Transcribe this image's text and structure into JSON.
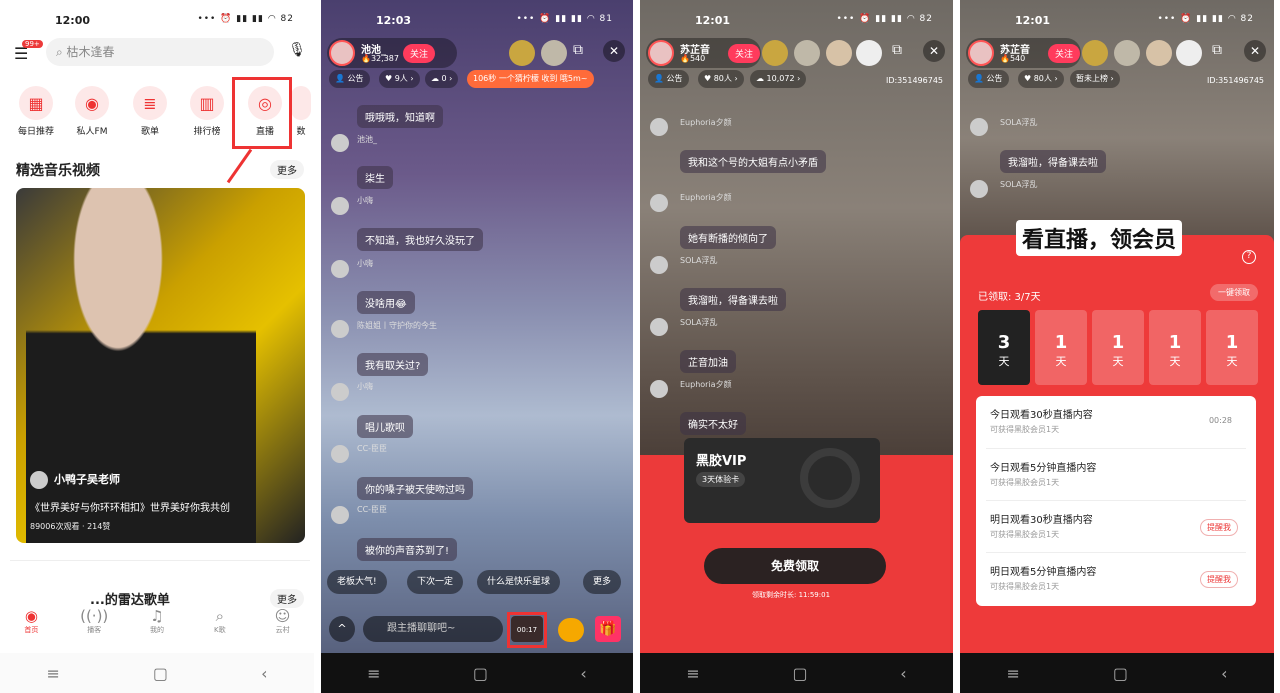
{
  "p1": {
    "time": "12:00",
    "battery": "82",
    "search_placeholder": "枯木逢春",
    "badge": "99+",
    "categories": [
      "每日推荐",
      "私人FM",
      "歌单",
      "排行榜",
      "直播",
      "数"
    ],
    "section_title": "精选音乐视频",
    "more": "更多",
    "video": {
      "author": "小鸭子吴老师",
      "title": "《世界美好与你环环相扣》世界美好你我共创",
      "stats": "89006次观看 · 214赞"
    },
    "section2": "...的雷达歌单",
    "more2": "更多",
    "tabs": [
      "首页",
      "播客",
      "我的",
      "K歌",
      "云村"
    ]
  },
  "p2": {
    "time": "12:03",
    "battery": "81",
    "host": "池池_",
    "fans": "32,387",
    "follow": "关注",
    "notice": "公告",
    "viewers": "9人",
    "likes": "0",
    "timer": "106秒",
    "task": "一个猜柠檬 收到 哦5m~",
    "messages": [
      "哦哦哦，知道啊",
      "柒生",
      "不知道，我也好久没玩了",
      "没啥用😂",
      "我有取关过?",
      "唱儿歌呗",
      "你的嗓子被天使吻过吗",
      "被你的声音苏到了!"
    ],
    "users": [
      "池池_",
      "小嗨",
      "小嗨",
      "陈姐姐丨守护你的今生",
      "小嗨",
      "CC-臣臣",
      "CC-臣臣"
    ],
    "quick": [
      "老板大气!",
      "下次一定",
      "什么是快乐星球",
      "更多"
    ],
    "input": "跟主播聊聊吧~",
    "vip_timer": "00:17"
  },
  "p3": {
    "time": "12:01",
    "battery": "82",
    "host": "苏芷音",
    "fans": "540",
    "follow": "关注",
    "notice": "公告",
    "viewers": "80人",
    "likes": "10,072",
    "room_id": "ID:351496745",
    "users": [
      "Euphoria夕颜",
      "Euphoria夕颜",
      "SOLA浮乱",
      "SOLA浮乱",
      "Euphoria夕颜"
    ],
    "messages": [
      "我和这个号的大姐有点小矛盾",
      "她有断播的倾向了",
      "我溜啦，得备课去啦",
      "芷音加油",
      "确实不太好"
    ],
    "card_title": "黑胶VIP",
    "card_sub": "3天体验卡",
    "claim": "免费领取",
    "claim_timer": "领取剩余时长: 11:59:01"
  },
  "p4": {
    "time": "12:01",
    "battery": "82",
    "host": "苏芷音",
    "fans": "540",
    "follow": "关注",
    "notice": "公告",
    "viewers": "80人",
    "rank": "暂未上榜",
    "room_id": "ID:351496745",
    "users": [
      "SOLA浮乱",
      "SOLA浮乱"
    ],
    "messages": [
      "我溜啦，得备课去啦"
    ],
    "banner": "看直播，领会员",
    "claimed": "已领取: 3/7天",
    "claim_all": "一键领取",
    "days": [
      {
        "n": "3",
        "u": "天"
      },
      {
        "n": "1",
        "u": "天"
      },
      {
        "n": "1",
        "u": "天"
      },
      {
        "n": "1",
        "u": "天"
      },
      {
        "n": "1",
        "u": "天"
      }
    ],
    "tasks": [
      {
        "a": "今日观看30秒直播内容",
        "b": "可获得黑胶会员1天",
        "r": "00:28"
      },
      {
        "a": "今日观看5分钟直播内容",
        "b": "可获得黑胶会员1天",
        "r": ""
      },
      {
        "a": "明日观看30秒直播内容",
        "b": "可获得黑胶会员1天",
        "r": "提醒我"
      },
      {
        "a": "明日观看5分钟直播内容",
        "b": "可获得黑胶会员1天",
        "r": "提醒我"
      }
    ]
  },
  "colors": {
    "accent": "#ec3a3a",
    "follow": "#ff3b5c"
  }
}
